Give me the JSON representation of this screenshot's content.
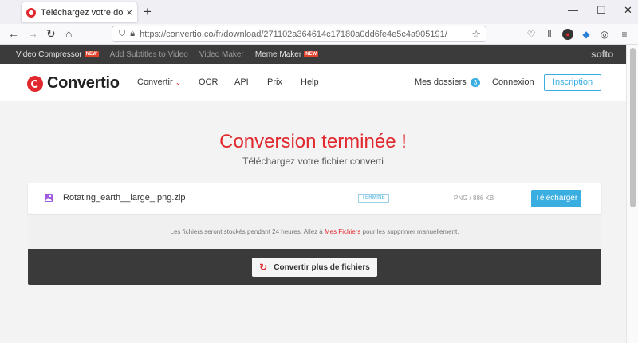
{
  "browser": {
    "tab_title": "Téléchargez votre dossier — Co",
    "tab_close": "×",
    "new_tab": "+",
    "minimize": "—",
    "maximize": "☐",
    "close": "✕",
    "back": "←",
    "forward": "→",
    "reload": "↻",
    "home": "⌂",
    "url": "https://convertio.co/fr/download/271102a364614c17180a0dd6fe4e5c4a905191/",
    "bookmark": "☆"
  },
  "softo_bar": {
    "items": [
      {
        "label": "Video Compressor",
        "badge": "NEW"
      },
      {
        "label": "Add Subtitles to Video"
      },
      {
        "label": "Video Maker"
      },
      {
        "label": "Meme Maker",
        "badge": "NEW"
      }
    ],
    "logo": "softo"
  },
  "header": {
    "logo_text": "Convertio",
    "nav": {
      "convertir": "Convertir",
      "ocr": "OCR",
      "api": "API",
      "prix": "Prix",
      "help": "Help"
    },
    "chevron": "⌄",
    "folders_label": "Mes dossiers",
    "folders_count": "3",
    "login": "Connexion",
    "signup": "Inscription"
  },
  "main": {
    "title": "Conversion terminée !",
    "subtitle": "Téléchargez votre fichier converti",
    "file": {
      "name": "Rotating_earth__large_.png.zip",
      "status": "TERMINÉ",
      "size": "PNG / 886 KB",
      "download": "Télécharger"
    },
    "info_before": "Les fichiers seront stockés pendant 24 heures. Allez à ",
    "info_link": "Mes Fichiers",
    "info_after": " pour les supprimer manuellement.",
    "more_icon": "↻",
    "more_button": "Convertir plus de fichiers"
  },
  "colors": {
    "brand_red": "#e0282e",
    "accent_blue": "#3aaee0",
    "dark_bar": "#3a3a3a"
  }
}
